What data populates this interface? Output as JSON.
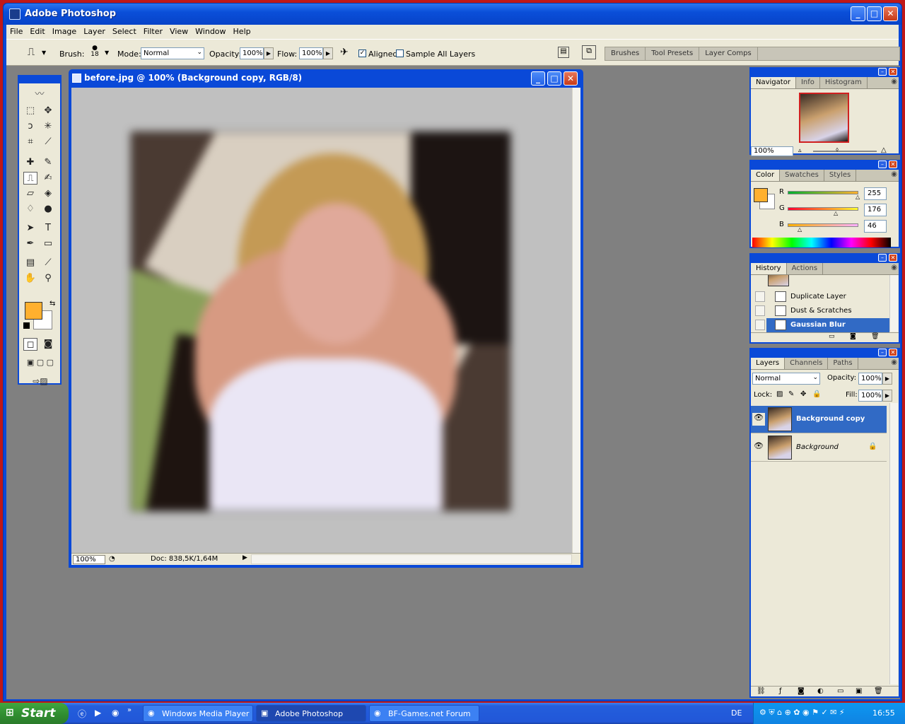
{
  "window": {
    "title": "Adobe Photoshop"
  },
  "menu": [
    "File",
    "Edit",
    "Image",
    "Layer",
    "Select",
    "Filter",
    "View",
    "Window",
    "Help"
  ],
  "options": {
    "brush_label": "Brush:",
    "brush_size": "18",
    "mode_label": "Mode:",
    "mode_value": "Normal",
    "opacity_label": "Opacity:",
    "opacity_value": "100%",
    "flow_label": "Flow:",
    "flow_value": "100%",
    "aligned_label": "Aligned",
    "aligned_checked": true,
    "sample_all_label": "Sample All Layers",
    "sample_all_checked": false,
    "palette_well": [
      "Brushes",
      "Tool Presets",
      "Layer Comps"
    ]
  },
  "colors": {
    "foreground": "#ffb02e",
    "background": "#ffffff",
    "titlebar": "#0a49d8",
    "selection": "#316ac5"
  },
  "document": {
    "title": "before.jpg @ 100% (Background copy, RGB/8)",
    "zoom": "100%",
    "doc_info": "Doc: 838,5K/1,64M"
  },
  "navigator": {
    "tabs": [
      "Navigator",
      "Info",
      "Histogram"
    ],
    "zoom": "100%"
  },
  "color_panel": {
    "tabs": [
      "Color",
      "Swatches",
      "Styles"
    ],
    "channels": [
      {
        "label": "R",
        "value": "255",
        "level": 1.0
      },
      {
        "label": "G",
        "value": "176",
        "level": 0.69
      },
      {
        "label": "B",
        "value": "46",
        "level": 0.18
      }
    ]
  },
  "history": {
    "tabs": [
      "History",
      "Actions"
    ],
    "items": [
      "Duplicate Layer",
      "Dust & Scratches",
      "Gaussian Blur"
    ],
    "selected_index": 2
  },
  "layers": {
    "tabs": [
      "Layers",
      "Channels",
      "Paths"
    ],
    "blend_mode": "Normal",
    "opacity_label": "Opacity:",
    "opacity": "100%",
    "lock_label": "Lock:",
    "fill_label": "Fill:",
    "fill": "100%",
    "items": [
      {
        "name": "Background copy",
        "selected": true
      },
      {
        "name": "Background",
        "selected": false,
        "locked": true
      }
    ]
  },
  "taskbar": {
    "start_label": "Start",
    "items": [
      "Windows Media Player",
      "Adobe Photoshop",
      "BF-Games.net Forum ..."
    ],
    "active_index": 1,
    "language": "DE",
    "clock": "16:55"
  }
}
